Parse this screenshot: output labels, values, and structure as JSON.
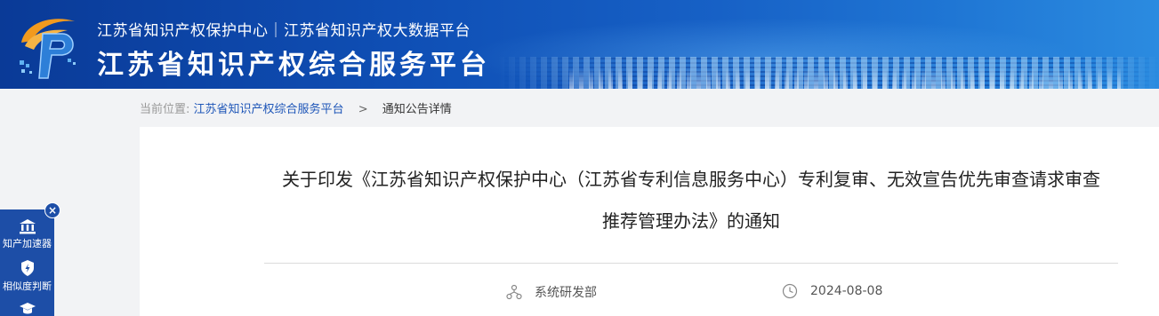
{
  "header": {
    "subtitle": "江苏省知识产权保护中心｜江苏省知识产权大数据平台",
    "title": "江苏省知识产权综合服务平台"
  },
  "breadcrumb": {
    "prefix": "当前位置:",
    "home_link": "江苏省知识产权综合服务平台",
    "separator": ">",
    "current": "通知公告详情"
  },
  "article": {
    "title_line1": "关于印发《江苏省知识产权保护中心（江苏省专利信息服务中心）专利复审、无效宣告优先审查请求审查",
    "title_line2": "推荐管理办法》的通知",
    "department": "系统研发部",
    "date": "2024-08-08"
  },
  "side_panel": {
    "close_symbol": "×",
    "items": [
      {
        "label": "知产加速器",
        "icon": "bank-icon"
      },
      {
        "label": "相似度判断",
        "icon": "shield-bolt-icon"
      },
      {
        "label": "",
        "icon": "graduation-cap-icon"
      }
    ]
  },
  "colors": {
    "banner_dark": "#0a3a97",
    "banner_light": "#2b8be0",
    "link_blue": "#1e56b8",
    "side_panel": "#1d4ea7"
  }
}
